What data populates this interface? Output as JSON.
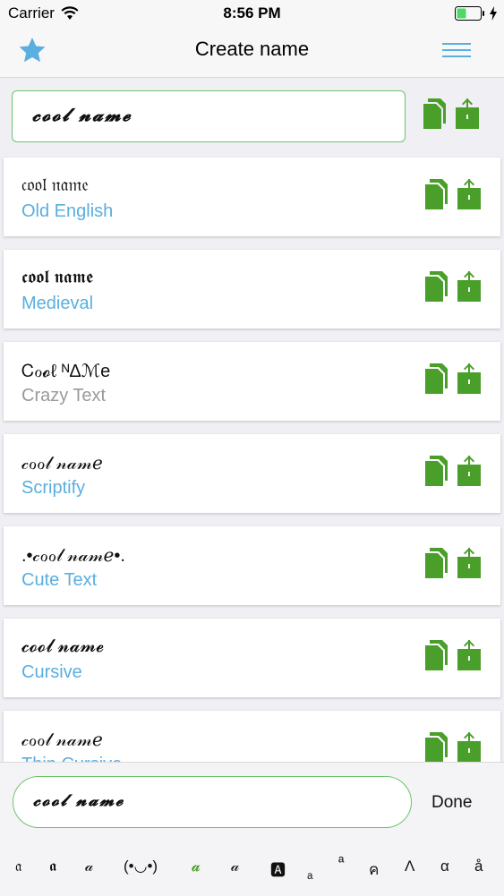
{
  "status_bar": {
    "carrier": "Carrier",
    "time": "8:56 PM"
  },
  "nav": {
    "title": "Create name",
    "star_icon": "star-icon",
    "menu_icon": "hamburger-menu-icon",
    "accent": "#5aaee0"
  },
  "top_input": {
    "value": "𝓬𝓸𝓸𝓵 𝓷𝓪𝓶𝓮"
  },
  "action_color": "#4a9e2a",
  "cards": [
    {
      "styled": "𝔠𝔬𝔬𝔩 𝔫𝔞𝔪𝔢",
      "name": "Old English"
    },
    {
      "styled": "𝖈𝖔𝖔𝖑 𝖓𝖆𝖒𝖊",
      "name": "Medieval"
    },
    {
      "styled": "Ꮯℴ𝓸ℓ ᴺΔℳe",
      "name": "Crazy Text"
    },
    {
      "styled": "𝒸ℴℴ𝓁 𝓃𝒶𝓂ℯ",
      "name": "Scriptify"
    },
    {
      "styled": ".•𝒸ℴℴ𝓁 𝓃𝒶𝓂ℯ•.",
      "name": "Cute Text"
    },
    {
      "styled": "𝓬𝓸𝓸𝓵 𝓷𝓪𝓶𝓮",
      "name": "Cursive"
    },
    {
      "styled": "𝒸ℴℴ𝓁 𝓃𝒶𝓂ℯ",
      "name": "Thin Cursive"
    }
  ],
  "bottom_input": {
    "value": "𝓬𝓸𝓸𝓵 𝓷𝓪𝓶𝓮"
  },
  "done_label": "Done",
  "font_keys": [
    "𝔞",
    "𝖆",
    "𝒶",
    "(•◡•)",
    "𝓪",
    "𝒶",
    "🅰",
    "ₐ",
    "ª",
    "ค",
    "Λ",
    "α",
    "å"
  ]
}
